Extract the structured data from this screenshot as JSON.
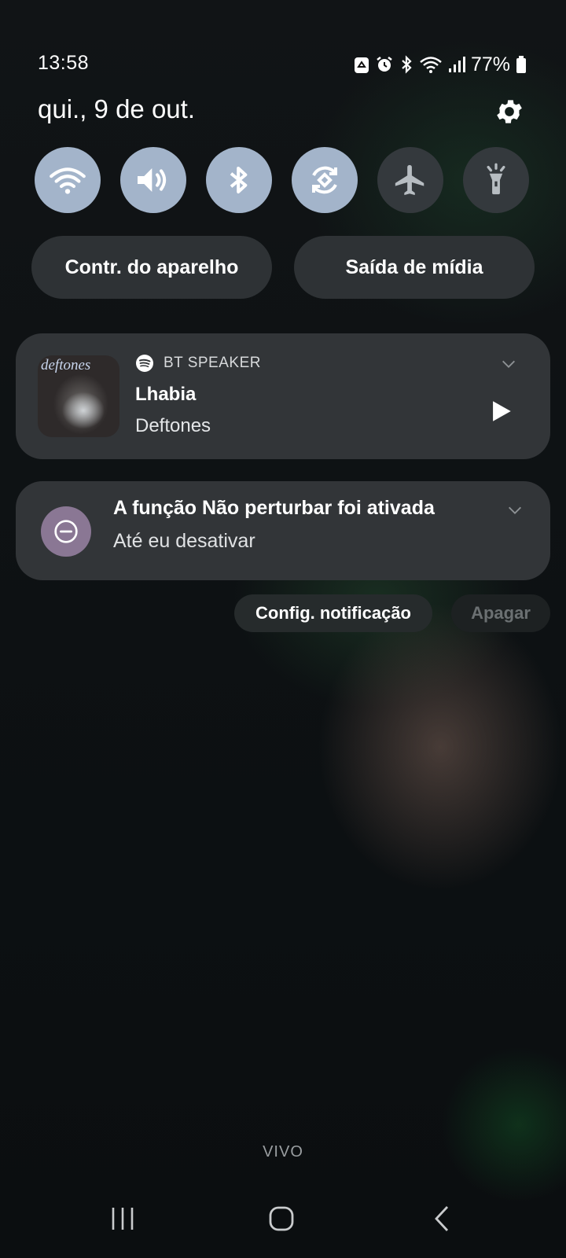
{
  "status_bar": {
    "time": "13:58",
    "battery_percent": "77%",
    "icons": [
      "recycle-icon",
      "alarm-icon",
      "bluetooth-icon",
      "wifi-icon",
      "signal-icon",
      "battery-icon"
    ]
  },
  "header": {
    "date": "qui., 9 de out."
  },
  "quick_toggles": [
    {
      "name": "wifi",
      "icon": "wifi-icon",
      "active": true
    },
    {
      "name": "sound",
      "icon": "volume-icon",
      "active": true
    },
    {
      "name": "bluetooth",
      "icon": "bluetooth-icon",
      "active": true
    },
    {
      "name": "auto-rotate",
      "icon": "rotate-icon",
      "active": true
    },
    {
      "name": "airplane",
      "icon": "airplane-icon",
      "active": false
    },
    {
      "name": "flashlight",
      "icon": "flashlight-icon",
      "active": false
    }
  ],
  "pills": {
    "device_control": "Contr. do aparelho",
    "media_output": "Saída de mídia"
  },
  "media": {
    "app_icon": "spotify-icon",
    "output_device": "BT SPEAKER",
    "title": "Lhabia",
    "artist": "Deftones",
    "album_art_text": "deftones"
  },
  "dnd_notification": {
    "title": "A função Não perturbar foi ativada",
    "subtitle": "Até eu desativar"
  },
  "actions": {
    "config": "Config. notificação",
    "clear": "Apagar"
  },
  "carrier": "VIVO",
  "colors": {
    "toggle_on": "#a3b4ca",
    "toggle_off": "#34393d",
    "card_bg": "#323538",
    "dnd_icon_bg": "#8a7794"
  }
}
